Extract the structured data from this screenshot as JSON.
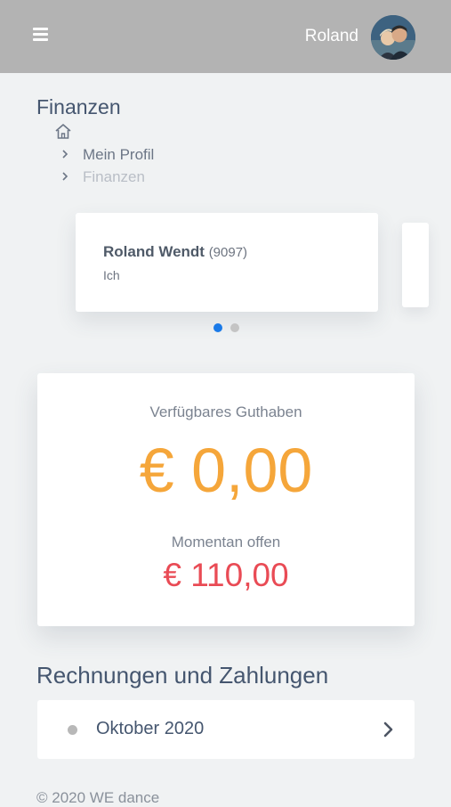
{
  "header": {
    "menu_icon": "hamburger-menu-icon",
    "username": "Roland",
    "avatar_icon": "user-avatar"
  },
  "page": {
    "title": "Finanzen"
  },
  "breadcrumb": {
    "home_icon": "home-icon",
    "items": [
      {
        "label": "Mein Profil"
      },
      {
        "label": "Finanzen"
      }
    ]
  },
  "profile_carousel": {
    "cards": [
      {
        "name": "Roland Wendt",
        "id": "(9097)",
        "role": "Ich"
      }
    ],
    "pagination": {
      "count": 2,
      "active": 0
    },
    "active_color": "#1a7ae8",
    "inactive_color": "#c4c4c4"
  },
  "balance": {
    "available_label": "Verfügbares Guthaben",
    "available_value": "€ 0,00",
    "available_color": "#f5a63a",
    "open_label": "Momentan offen",
    "open_value": "€ 110,00",
    "open_color": "#e94b55"
  },
  "invoices": {
    "title": "Rechnungen und Zahlungen",
    "items": [
      {
        "label": "Oktober 2020",
        "chevron_icon": "chevron-right-icon"
      }
    ]
  },
  "footer": {
    "text": "© 2020 WE dance"
  }
}
